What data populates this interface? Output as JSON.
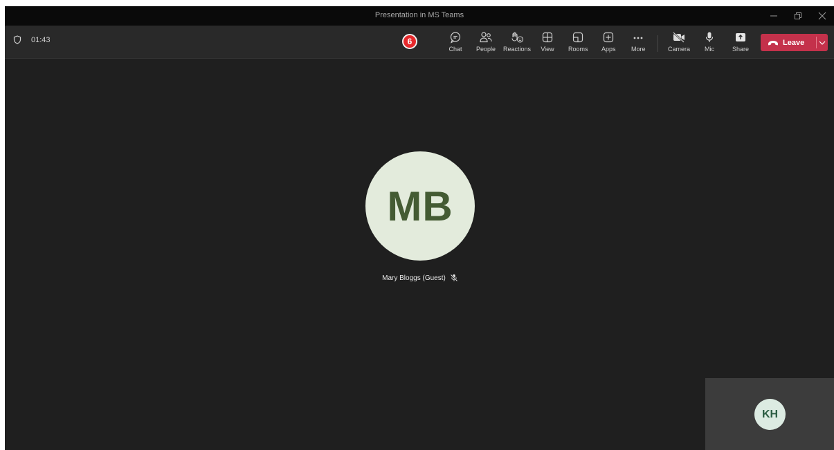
{
  "window": {
    "title": "Presentation in MS Teams",
    "controls": [
      "minimize-icon",
      "restore-icon",
      "close-icon"
    ]
  },
  "meeting": {
    "timer": "01:43",
    "badge_count": "6"
  },
  "toolbar": {
    "chat": "Chat",
    "people": "People",
    "reactions": "Reactions",
    "view": "View",
    "rooms": "Rooms",
    "apps": "Apps",
    "more": "More",
    "camera": "Camera",
    "mic": "Mic",
    "share": "Share",
    "leave": "Leave"
  },
  "stage": {
    "main_participant": {
      "initials": "MB",
      "name": "Mary Bloggs (Guest)",
      "muted": true
    },
    "self_view": {
      "initials": "KH"
    }
  },
  "colors": {
    "leave_button": "#c4314b",
    "badge": "#e6292c",
    "main_avatar_bg": "#e3ebdc",
    "main_avatar_text": "#445b33"
  }
}
